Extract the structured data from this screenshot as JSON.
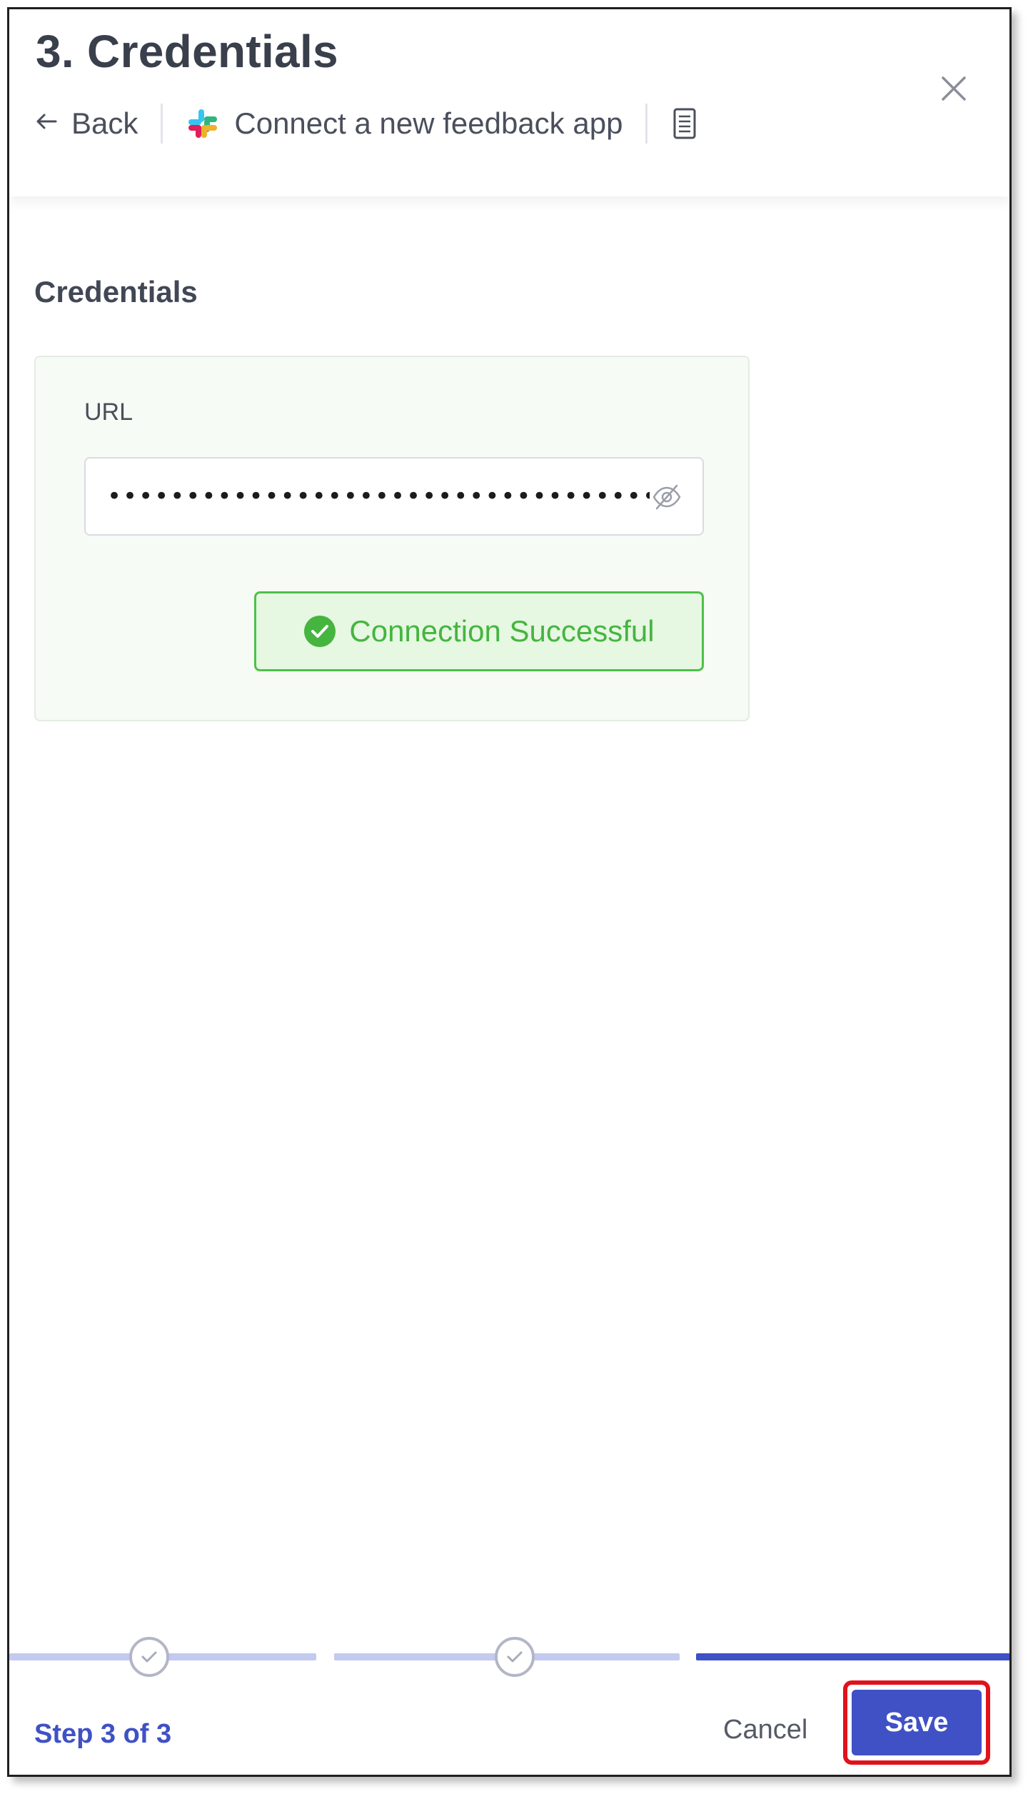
{
  "header": {
    "title": "3. Credentials",
    "back_label": "Back",
    "app_link_label": "Connect a new feedback app"
  },
  "credentials": {
    "section_title": "Credentials",
    "url_label": "URL",
    "url_value": "••••••••••••••••••••••••••••••••••••••",
    "connection_status": "Connection Successful"
  },
  "footer": {
    "step_text": "Step 3 of 3",
    "cancel_label": "Cancel",
    "save_label": "Save"
  },
  "colors": {
    "primary": "#3f51c5",
    "success": "#45b53f",
    "highlight": "#e0121b"
  }
}
